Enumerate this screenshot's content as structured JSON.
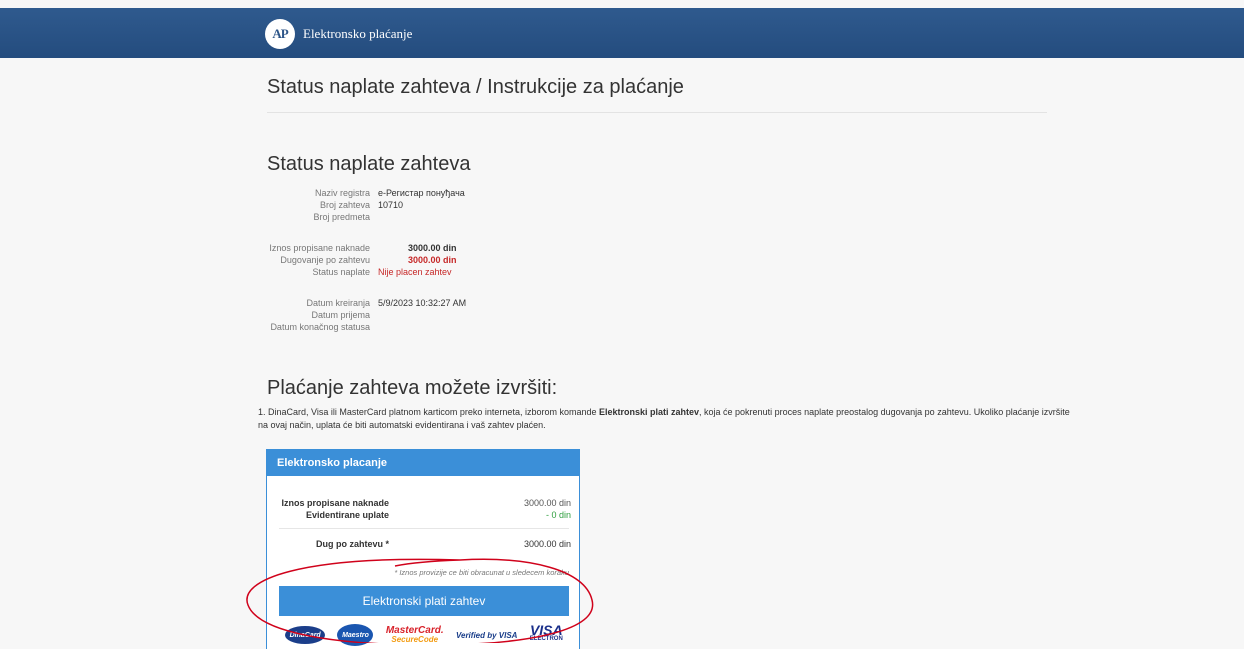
{
  "header": {
    "logo_text": "AP",
    "brand_name": "Elektronsko plaćanje"
  },
  "page_title": "Status naplate zahteva / Instrukcije za plaćanje",
  "status_section": {
    "title": "Status naplate zahteva",
    "group1": [
      {
        "label": "Naziv registra",
        "value": "е-Регистар понуђача"
      },
      {
        "label": "Broj zahteva",
        "value": "10710"
      },
      {
        "label": "Broj predmeta",
        "value": ""
      }
    ],
    "group2": [
      {
        "label": "Iznos propisane naknade",
        "value": "3000.00 din"
      },
      {
        "label": "Dugovanje po zahtevu",
        "value": "3000.00 din"
      },
      {
        "label": "Status naplate",
        "value": "Nije placen zahtev"
      }
    ],
    "group3": [
      {
        "label": "Datum kreiranja",
        "value": "5/9/2023 10:32:27 AM"
      },
      {
        "label": "Datum prijema",
        "value": ""
      },
      {
        "label": "Datum konačnog statusa",
        "value": ""
      }
    ]
  },
  "payment_section": {
    "title": "Plaćanje zahteva možete izvršiti:",
    "instruction_pre": "1. DinaCard, Visa ili MasterCard platnom karticom preko interneta, izborom komande ",
    "instruction_bold": "Elektronski plati zahtev",
    "instruction_post": ", koja će pokrenuti proces naplate preostalog dugovanja po zahtevu. Ukoliko plaćanje izvršite na ovaj način, uplata će biti automatski evidentirana i vaš zahtev plaćen."
  },
  "panel": {
    "title": "Elektronsko placanje",
    "fee_label": "Iznos propisane naknade",
    "fee_value": "3000.00 din",
    "paid_label": "Evidentirane uplate",
    "paid_value": "- 0 din",
    "debt_label": "Dug po zahtevu *",
    "debt_value": "3000.00 din",
    "note": "* Iznos provizije ce biti obracunat u sledecem koraku",
    "button_label": "Elektronski plati zahtev",
    "cards": {
      "dinacard": "DinaCard",
      "maestro": "Maestro",
      "mastercard": "MasterCard.",
      "mastercard_sub": "SecureCode",
      "verified": "Verified by VISA",
      "visa": "VISA",
      "visa_sub": "ELECTRON"
    }
  },
  "colors": {
    "header": "#2d5588",
    "accent": "#3b8fd8",
    "alert": "#c62828",
    "positive": "#2e9e3e",
    "annotation": "#d0021b"
  }
}
